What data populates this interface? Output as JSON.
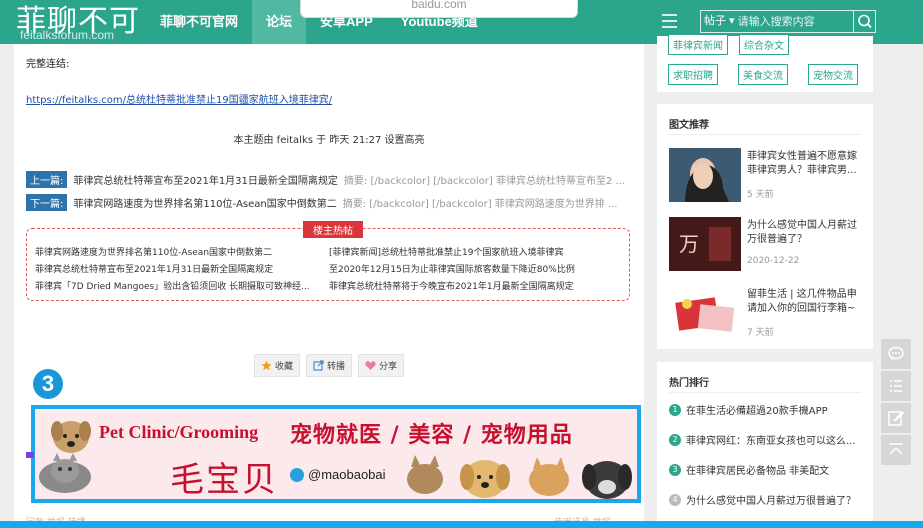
{
  "header": {
    "logo_text": "菲聊不可",
    "logo_sub": "feitalksforum.com",
    "nav": [
      {
        "label": "菲聊不可官网",
        "active": false
      },
      {
        "label": "论坛",
        "active": true
      },
      {
        "label": "安卓APP",
        "active": false
      },
      {
        "label": "Youtube频道",
        "active": false
      }
    ],
    "popup_text": "baidu.com",
    "search": {
      "select_label": "帖子 ▾",
      "placeholder": "请输入搜索内容"
    }
  },
  "post": {
    "full_link_label": "完整连结:",
    "url": "https://feitalks.com/总统杜特蒂批准禁止19国疆家航班入境菲律宾/",
    "edit_note": "本主题由 feitalks 于 昨天 21:27 设置高亮",
    "prev": {
      "tag": "上一篇:",
      "title": "菲律宾总统杜特蒂宣布至2021年1月31日最新全国隔离规定",
      "summary": "摘要: [/backcolor] [/backcolor] 菲律宾总统杜特蒂宣布至2 ..."
    },
    "next": {
      "tag": "下一篇:",
      "title": "菲律宾网路速度为世界排名第110位-Asean国家中倒数第二",
      "summary": "摘要: [/backcolor] [/backcolor] 菲律宾网路速度为世界排 ..."
    },
    "hot_title": "楼主热帖",
    "hot_items": [
      "菲律宾网路速度为世界排名第110位-Asean国家中倒数第二",
      "[菲律宾新闻]总统杜特蒂批准禁止19个国家航班入境菲律宾",
      "菲律宾总统杜特蒂宣布至2021年1月31日最新全国隔离规定",
      "至2020年12月15日为止菲律宾国际旅客数量下降近80%比例",
      "菲律宾「7D Dried Mangoes」验出含铅须回收 长期摄取可致神经...",
      "菲律宾总统杜特蒂将于今晚宣布2021年1月最新全国隔离规定"
    ],
    "share_buttons": [
      "收藏",
      "转播",
      "分享"
    ],
    "badge": "3",
    "ad": {
      "en": "Pet Clinic/Grooming",
      "cn": "宠物就医 / 美容 / 宠物用品",
      "brand": "毛宝贝",
      "handle": "@maobaobai"
    },
    "bottom_left": "回复   举报   转播",
    "bottom_right": "使用道具   举报"
  },
  "sidebar": {
    "tags": [
      "菲律宾新闻",
      "综合杂文",
      "求职招聘",
      "美食交流",
      "宠物交流"
    ],
    "recommend_title": "图文推荐",
    "recommend": [
      {
        "title": "菲律宾女性普遍不愿意嫁菲律宾男人？菲律宾男...",
        "date": "5 天前"
      },
      {
        "title": "为什么感觉中国人月薪过万很普遍了？",
        "date": "2020-12-22"
      },
      {
        "title": "留菲生活 | 这几件物品申请加入你的回国行李箱~",
        "date": "7 天前"
      }
    ],
    "hot_title": "热门排行",
    "hot": [
      {
        "rank": "1",
        "title": "在菲生活必備超過20款手機APP"
      },
      {
        "rank": "2",
        "title": "菲律宾网红：东南亚女孩也可以这么..."
      },
      {
        "rank": "3",
        "title": "在菲律宾居民必备物品 非美配文"
      },
      {
        "rank": "4",
        "title": "为什么感觉中国人月薪过万很普遍了？"
      }
    ]
  },
  "floating": [
    "comment-icon",
    "list-icon",
    "edit-icon",
    "back-to-top-icon"
  ]
}
